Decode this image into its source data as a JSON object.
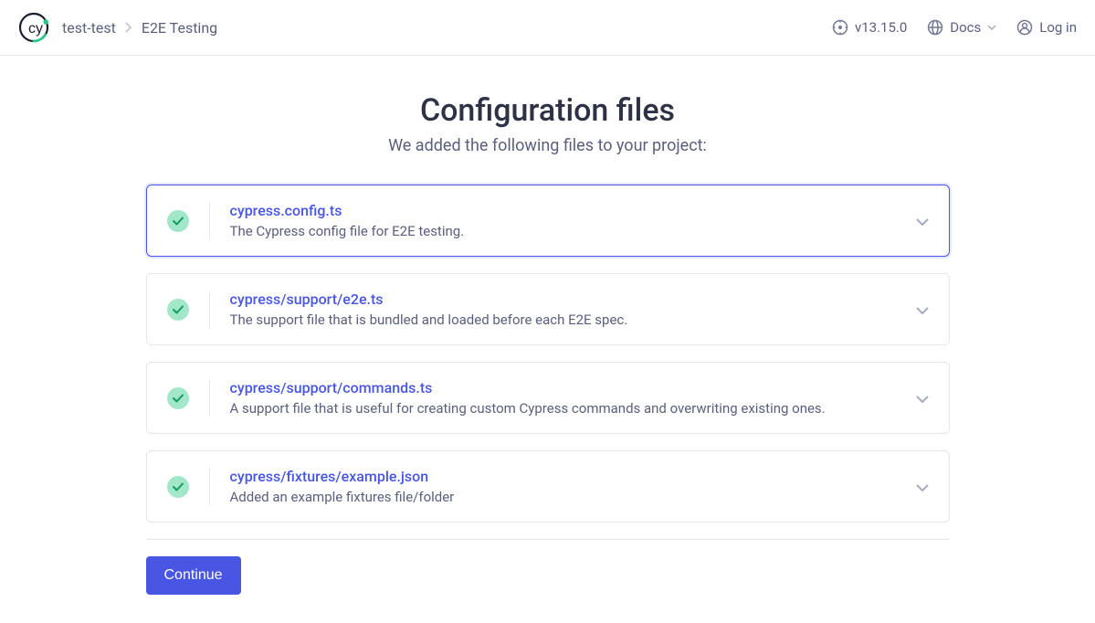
{
  "header": {
    "project": "test-test",
    "section": "E2E Testing",
    "version": "v13.15.0",
    "docs": "Docs",
    "login": "Log in"
  },
  "main": {
    "title": "Configuration files",
    "subtitle": "We added the following files to your project:",
    "continue": "Continue"
  },
  "files": [
    {
      "name": "cypress.config.ts",
      "desc": "The Cypress config file for E2E testing."
    },
    {
      "name": "cypress/support/e2e.ts",
      "desc": "The support file that is bundled and loaded before each E2E spec."
    },
    {
      "name": "cypress/support/commands.ts",
      "desc": "A support file that is useful for creating custom Cypress commands and overwriting existing ones."
    },
    {
      "name": "cypress/fixtures/example.json",
      "desc": "Added an example fixtures file/folder"
    }
  ]
}
